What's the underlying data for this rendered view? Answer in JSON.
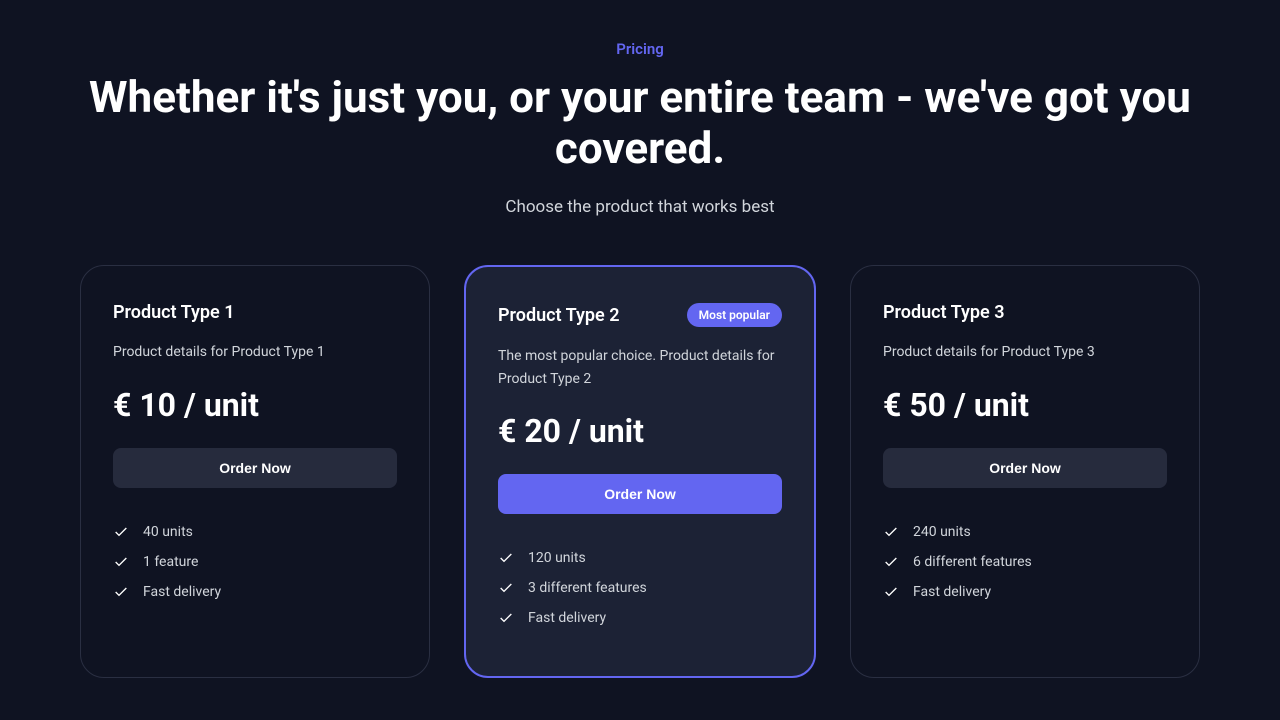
{
  "eyebrow": "Pricing",
  "headline": "Whether it's just you, or your entire team - we've got you covered.",
  "subhead": "Choose the product that works best",
  "badge_label": "Most popular",
  "products": [
    {
      "title": "Product Type 1",
      "desc": "Product details for Product Type 1",
      "price": "€ 10 / unit",
      "cta": "Order Now",
      "features": [
        "40 units",
        "1 feature",
        "Fast delivery"
      ]
    },
    {
      "title": "Product Type 2",
      "desc": "The most popular choice. Product details for Product Type 2",
      "price": "€ 20 / unit",
      "cta": "Order Now",
      "features": [
        "120 units",
        "3 different features",
        "Fast delivery"
      ]
    },
    {
      "title": "Product Type 3",
      "desc": "Product details for Product Type 3",
      "price": "€ 50 / unit",
      "cta": "Order Now",
      "features": [
        "240 units",
        "6 different features",
        "Fast delivery"
      ]
    }
  ]
}
